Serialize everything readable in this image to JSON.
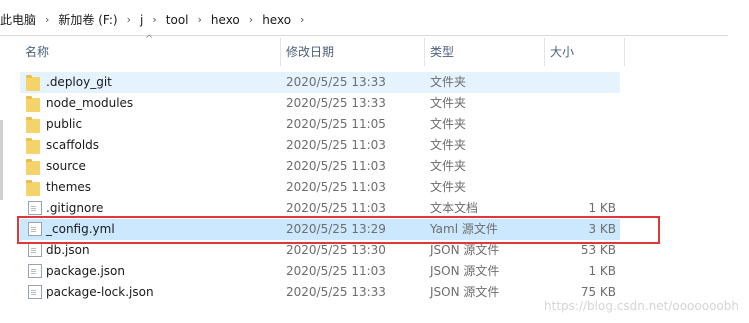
{
  "breadcrumb": {
    "items": [
      "此电脑",
      "新加卷 (F:)",
      "j",
      "tool",
      "hexo",
      "hexo"
    ],
    "separator": "›"
  },
  "columns": {
    "name": "名称",
    "date": "修改日期",
    "type": "类型",
    "size": "大小",
    "sort_arrow": "^"
  },
  "files": [
    {
      "name": ".deploy_git",
      "date": "2020/5/25 13:33",
      "type": "文件夹",
      "size": "",
      "icon": "folder-icon"
    },
    {
      "name": "node_modules",
      "date": "2020/5/25 13:33",
      "type": "文件夹",
      "size": "",
      "icon": "folder-icon"
    },
    {
      "name": "public",
      "date": "2020/5/25 11:05",
      "type": "文件夹",
      "size": "",
      "icon": "folder-icon"
    },
    {
      "name": "scaffolds",
      "date": "2020/5/25 11:03",
      "type": "文件夹",
      "size": "",
      "icon": "folder-icon"
    },
    {
      "name": "source",
      "date": "2020/5/25 11:03",
      "type": "文件夹",
      "size": "",
      "icon": "folder-icon"
    },
    {
      "name": "themes",
      "date": "2020/5/25 11:03",
      "type": "文件夹",
      "size": "",
      "icon": "folder-icon"
    },
    {
      "name": ".gitignore",
      "date": "2020/5/25 11:03",
      "type": "文本文档",
      "size": "1 KB",
      "icon": "text-file-icon"
    },
    {
      "name": "_config.yml",
      "date": "2020/5/25 13:29",
      "type": "Yaml 源文件",
      "size": "3 KB",
      "icon": "yaml-file-icon"
    },
    {
      "name": "db.json",
      "date": "2020/5/25 13:30",
      "type": "JSON 源文件",
      "size": "53 KB",
      "icon": "json-file-icon"
    },
    {
      "name": "package.json",
      "date": "2020/5/25 11:03",
      "type": "JSON 源文件",
      "size": "1 KB",
      "icon": "json-file-icon"
    },
    {
      "name": "package-lock.json",
      "date": "2020/5/25 13:33",
      "type": "JSON 源文件",
      "size": "75 KB",
      "icon": "json-file-icon"
    }
  ],
  "watermark": "https://blog.csdn.net/ooooooobh",
  "colors": {
    "hover_row": "#e5f3ff",
    "selected_row": "#cce8ff",
    "highlight_border": "#e0373b",
    "folder": "#f4d36b"
  }
}
